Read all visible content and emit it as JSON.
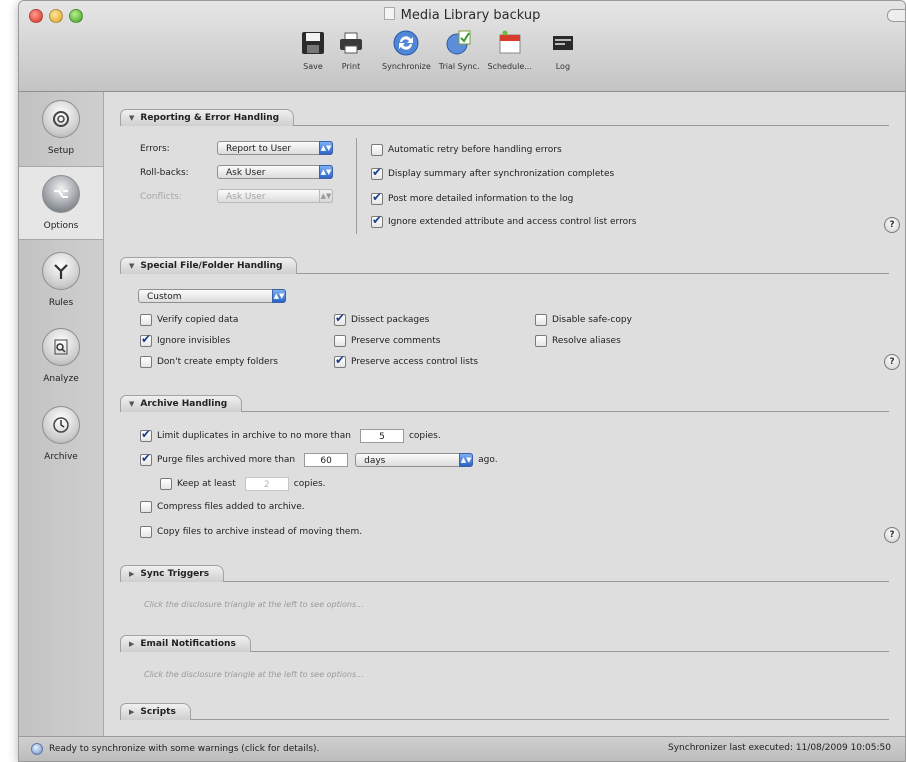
{
  "window": {
    "title": "Media Library backup"
  },
  "toolbar": [
    {
      "label": "Save",
      "icon": "floppy-disk-icon"
    },
    {
      "label": "Print",
      "icon": "printer-icon"
    },
    {
      "label": "Synchronize",
      "icon": "sync-arrows-icon"
    },
    {
      "label": "Trial Sync.",
      "icon": "trial-sync-icon"
    },
    {
      "label": "Schedule...",
      "icon": "calendar-icon"
    },
    {
      "label": "Log",
      "icon": "log-icon"
    }
  ],
  "sidebar": [
    {
      "label": "Setup",
      "icon": "setup-icon"
    },
    {
      "label": "Options",
      "icon": "options-icon"
    },
    {
      "label": "Rules",
      "icon": "rules-icon"
    },
    {
      "label": "Analyze",
      "icon": "analyze-icon"
    },
    {
      "label": "Archive",
      "icon": "archive-icon"
    }
  ],
  "reporting": {
    "title": "Reporting & Error Handling",
    "errors_label": "Errors:",
    "errors_value": "Report to User",
    "rollbacks_label": "Roll-backs:",
    "rollbacks_value": "Ask User",
    "conflicts_label": "Conflicts:",
    "conflicts_value": "Ask User",
    "checks": [
      {
        "label": "Automatic retry before handling errors",
        "checked": false
      },
      {
        "label": "Display summary after synchronization completes",
        "checked": true
      },
      {
        "label": "Post more detailed information to the log",
        "checked": true
      },
      {
        "label": "Ignore extended attribute and access control list errors",
        "checked": true
      }
    ]
  },
  "special": {
    "title": "Special File/Folder Handling",
    "preset": "Custom",
    "checks": [
      {
        "label": "Verify copied data",
        "checked": false
      },
      {
        "label": "Ignore invisibles",
        "checked": true
      },
      {
        "label": "Don't create empty folders",
        "checked": false
      },
      {
        "label": "Dissect packages",
        "checked": true
      },
      {
        "label": "Preserve comments",
        "checked": false
      },
      {
        "label": "Preserve access control lists",
        "checked": true
      },
      {
        "label": "Disable safe-copy",
        "checked": false
      },
      {
        "label": "Resolve aliases",
        "checked": false
      }
    ]
  },
  "archive": {
    "title": "Archive Handling",
    "limit_label": "Limit duplicates in archive to no more than",
    "limit_value": "5",
    "limit_suffix": "copies.",
    "purge_label": "Purge files archived more than",
    "purge_value": "60",
    "purge_unit": "days",
    "purge_suffix": "ago.",
    "keep_label": "Keep at least",
    "keep_value": "2",
    "keep_suffix": "copies.",
    "compress_label": "Compress files added to archive.",
    "copy_label": "Copy files to archive instead of moving them.",
    "limit_checked": true,
    "purge_checked": true,
    "keep_checked": false,
    "compress_checked": false,
    "copy_checked": false
  },
  "triggers": {
    "title": "Sync Triggers",
    "hint": "Click the disclosure triangle at the left to see options..."
  },
  "email": {
    "title": "Email Notifications",
    "hint": "Click the disclosure triangle at the left to see options..."
  },
  "scripts": {
    "title": "Scripts"
  },
  "help_label": "?",
  "status": {
    "left": "Ready to synchronize with some warnings (click for details).",
    "right": "Synchronizer last executed:  11/08/2009 10:05:50"
  }
}
